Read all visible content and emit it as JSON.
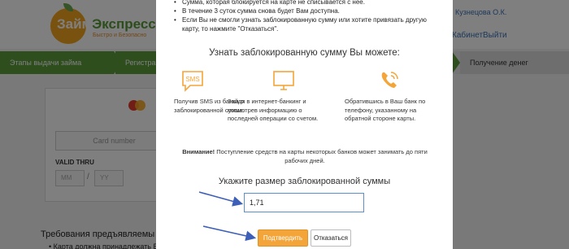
{
  "logo": {
    "main_a": "Займ",
    "main_b": "Экспресс",
    "sub": "Быстро и Безопасно"
  },
  "header": {
    "user": "Кузнецова О.К.",
    "links": [
      "Кабинет",
      "Выйти"
    ]
  },
  "steps": [
    {
      "label": "Этапы выдачи займа"
    },
    {
      "label": "Регистрац"
    },
    {
      "label": "Получение денег"
    }
  ],
  "card_form": {
    "card_number_placeholder": "Card number",
    "valid_thru_label": "VALID THRU",
    "month_placeholder": "MM",
    "year_placeholder": "YY",
    "slash": "/"
  },
  "requirements": {
    "title": "Требования предъявляемы",
    "item": "Карта должна принадлежать Ва"
  },
  "modal": {
    "info_items": [
      "Сумма, которая блокируется на карте не списывается с нее.",
      "В течение 3 суток сумма снова будет Вам доступна.",
      "Если Вы не смогли узнать заблокированную сумму или хотите привязать другую карту, то нажмите \"Отказаться\"."
    ],
    "options_title": "Узнать заблокированную сумму Вы можете:",
    "options": [
      {
        "icon": "sms-icon",
        "icon_text": "SMS",
        "text": "Получив SMS из банка о заблокированной сумме."
      },
      {
        "icon": "monitor-icon",
        "text": "Зайдя в интернет-банкинг и посмотрев информацию о последней операции со счетом."
      },
      {
        "icon": "phone-icon",
        "text": "Обратившись в Ваш банк по телефону, указанному на обратной стороне карты."
      }
    ],
    "notice_bold": "Внимание!",
    "notice_text": " Поступление средств на карты некоторых банков может занимать до пяти рабочих дней.",
    "amount_title": "Укажите размер заблокированной суммы",
    "amount_value": "1,71",
    "confirm_label": "Подтвердить",
    "cancel_label": "Отказаться"
  },
  "colors": {
    "accent_orange": "#f4a53a",
    "step_green": "#5c9d3d",
    "link_blue": "#3b6fb5",
    "annotation_arrow": "#3d5fb8"
  }
}
